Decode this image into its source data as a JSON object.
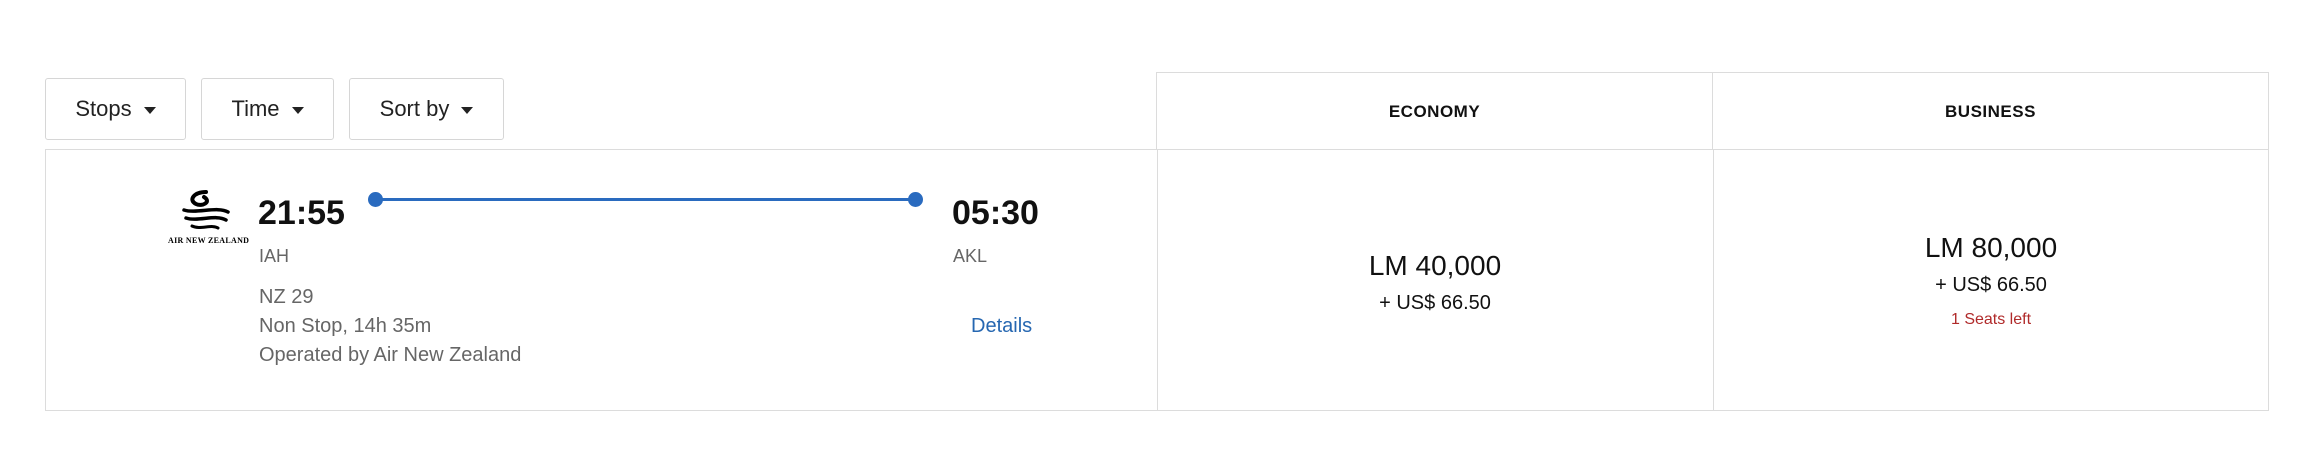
{
  "filters": {
    "stops_label": "Stops",
    "time_label": "Time",
    "sort_label": "Sort by"
  },
  "cabins": {
    "economy_label": "ECONOMY",
    "business_label": "BUSINESS"
  },
  "flight": {
    "airline_logo_text": "AIR NEW ZEALAND",
    "departure_time": "21:55",
    "departure_airport": "IAH",
    "arrival_time": "05:30",
    "arrival_airport": "AKL",
    "flight_number": "NZ 29",
    "stops_duration": "Non Stop, 14h 35m",
    "operated_by": "Operated by Air New Zealand",
    "details_label": "Details"
  },
  "prices": {
    "economy": {
      "points": "LM 40,000",
      "tax": "+ US$ 66.50"
    },
    "business": {
      "points": "LM 80,000",
      "tax": "+ US$ 66.50",
      "seats_left": "1 Seats left"
    }
  },
  "colors": {
    "accent": "#2a6bbf",
    "link": "#2667b1",
    "warning": "#b02a2a",
    "border": "#dcdcdc"
  },
  "icons": {
    "caret": "chevron-down-icon",
    "airline": "air-new-zealand-koru-logo"
  }
}
